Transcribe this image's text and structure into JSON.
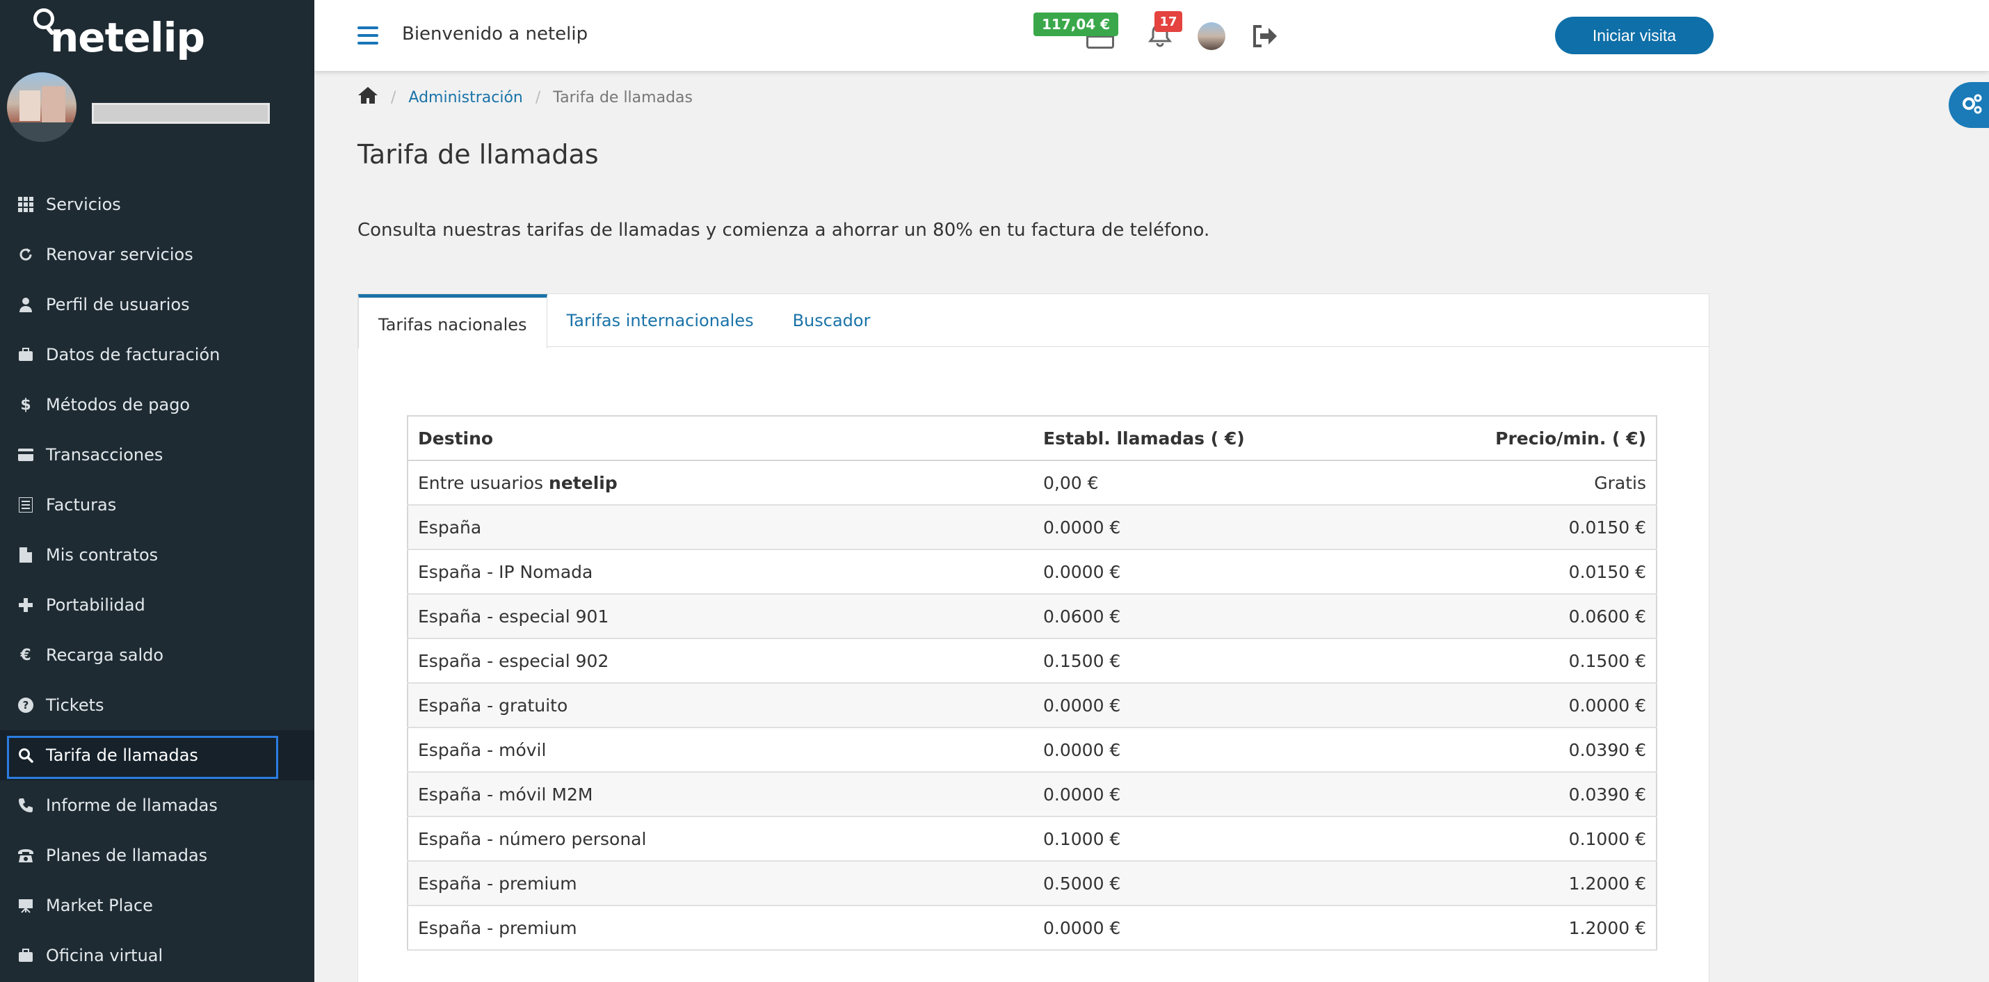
{
  "brand": {
    "name": "netelip"
  },
  "sidebar": {
    "items": [
      {
        "label": "Servicios",
        "icon": "grid-icon"
      },
      {
        "label": "Renovar servicios",
        "icon": "refresh-icon"
      },
      {
        "label": "Perfil de usuarios",
        "icon": "user-icon"
      },
      {
        "label": "Datos de facturación",
        "icon": "briefcase-icon"
      },
      {
        "label": "Métodos de pago",
        "icon": "dollar-icon"
      },
      {
        "label": "Transacciones",
        "icon": "credit-card-icon"
      },
      {
        "label": "Facturas",
        "icon": "list-icon"
      },
      {
        "label": "Mis contratos",
        "icon": "file-icon"
      },
      {
        "label": "Portabilidad",
        "icon": "plus-icon"
      },
      {
        "label": "Recarga saldo",
        "icon": "euro-icon"
      },
      {
        "label": "Tickets",
        "icon": "question-icon"
      },
      {
        "label": "Tarifa de llamadas",
        "icon": "search-icon"
      },
      {
        "label": "Informe de llamadas",
        "icon": "phone-icon"
      },
      {
        "label": "Planes de llamadas",
        "icon": "telephone-icon"
      },
      {
        "label": "Market Place",
        "icon": "easel-icon"
      },
      {
        "label": "Oficina virtual",
        "icon": "briefcase-icon"
      }
    ],
    "active_index": 11
  },
  "header": {
    "welcome": "Bienvenido a netelip",
    "visit_button": "Iniciar visita",
    "balance": "117,04 €",
    "notifications_count": "17"
  },
  "breadcrumb": {
    "level1": "Administración",
    "level2": "Tarifa de llamadas"
  },
  "page": {
    "title": "Tarifa de llamadas",
    "intro": "Consulta nuestras tarifas de llamadas y comienza a ahorrar un 80% en tu factura de teléfono."
  },
  "tabs": [
    {
      "label": "Tarifas nacionales",
      "active": true
    },
    {
      "label": "Tarifas internacionales",
      "active": false
    },
    {
      "label": "Buscador",
      "active": false
    }
  ],
  "table": {
    "headers": [
      "Destino",
      "Establ. llamadas ( €)",
      "Precio/min. ( €)"
    ],
    "rows": [
      {
        "dest": "Entre usuarios ",
        "dest_bold": "netelip",
        "setup": "0,00 €",
        "price": "Gratis"
      },
      {
        "dest": "España",
        "setup": "0.0000 €",
        "price": "0.0150 €"
      },
      {
        "dest": "España - IP Nomada",
        "setup": "0.0000 €",
        "price": "0.0150 €"
      },
      {
        "dest": "España - especial 901",
        "setup": "0.0600 €",
        "price": "0.0600 €"
      },
      {
        "dest": "España - especial 902",
        "setup": "0.1500 €",
        "price": "0.1500 €"
      },
      {
        "dest": "España - gratuito",
        "setup": "0.0000 €",
        "price": "0.0000 €"
      },
      {
        "dest": "España - móvil",
        "setup": "0.0000 €",
        "price": "0.0390 €"
      },
      {
        "dest": "España - móvil M2M",
        "setup": "0.0000 €",
        "price": "0.0390 €"
      },
      {
        "dest": "España - número personal",
        "setup": "0.1000 €",
        "price": "0.1000 €"
      },
      {
        "dest": "España - premium",
        "setup": "0.5000 €",
        "price": "1.2000 €"
      },
      {
        "dest": "España - premium",
        "setup": "0.0000 €",
        "price": "1.2000 €"
      }
    ]
  },
  "colors": {
    "sidebar_bg": "#1f2b33",
    "accent": "#1a73a8",
    "balance_badge": "#3aa84a",
    "notif_badge": "#e4433f"
  }
}
